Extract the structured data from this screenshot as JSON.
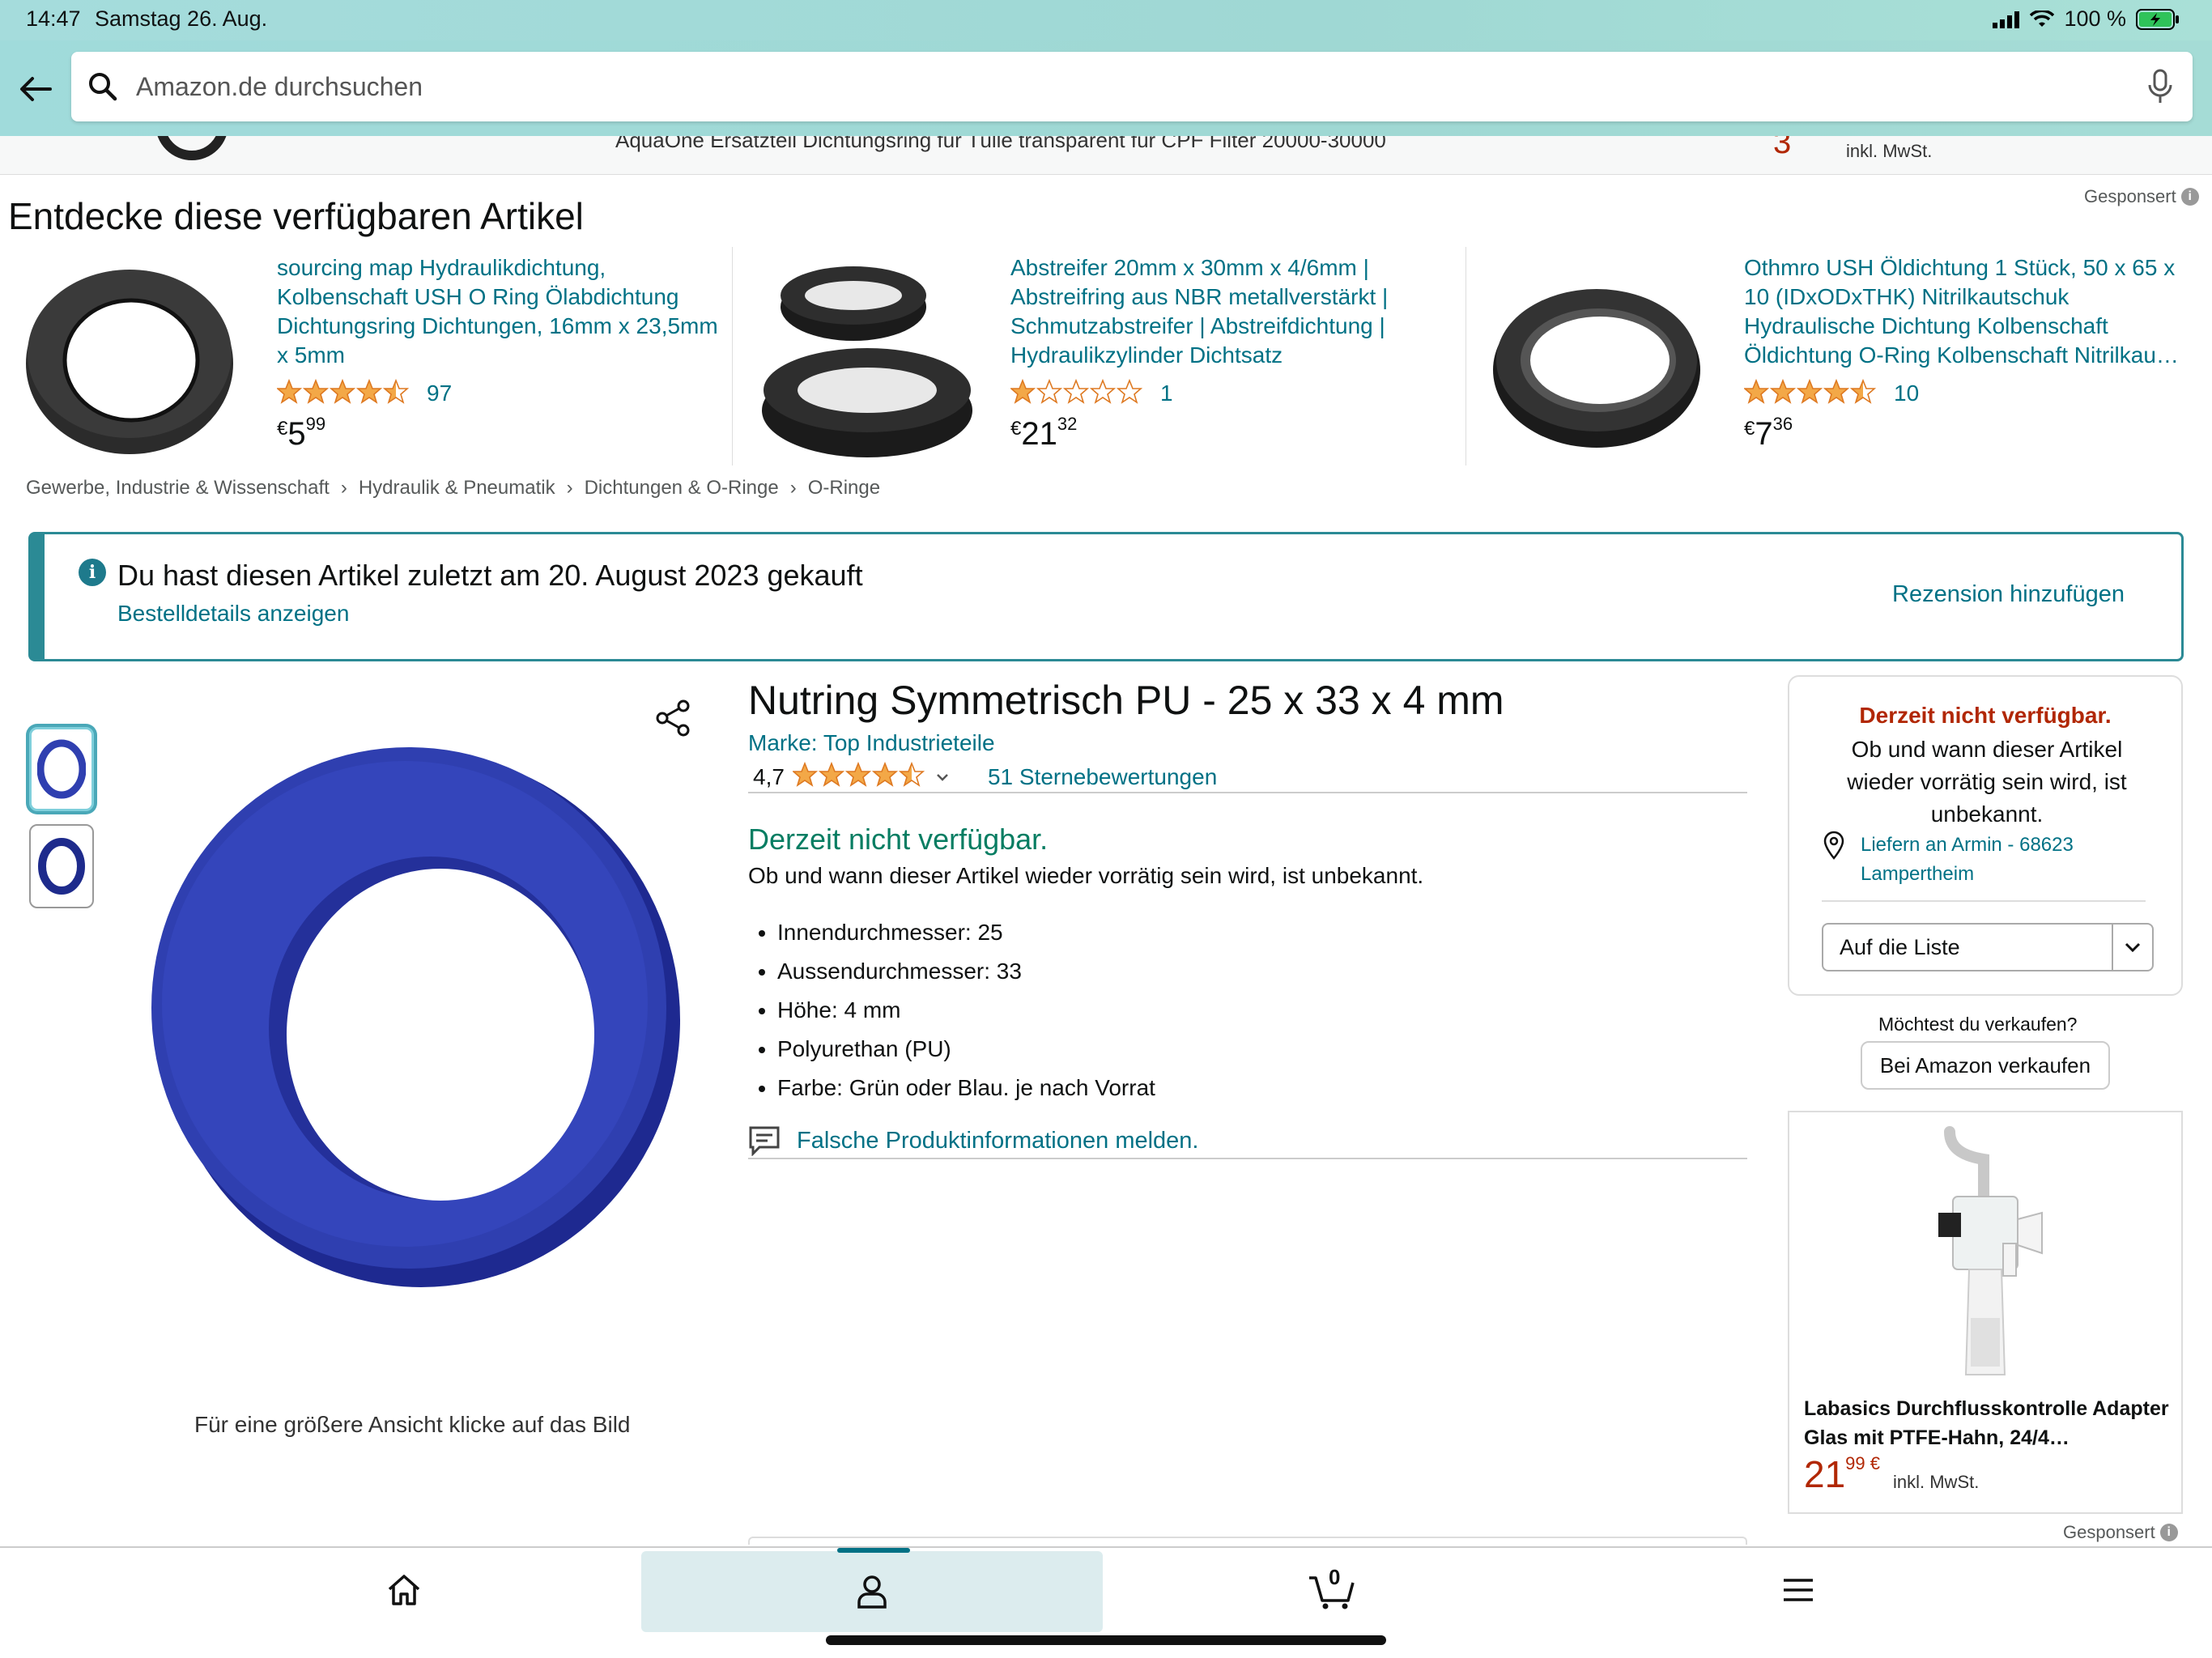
{
  "status_bar": {
    "time": "14:47",
    "date": "Samstag 26. Aug.",
    "battery": "100 %"
  },
  "search": {
    "placeholder": "Amazon.de durchsuchen"
  },
  "sticky": {
    "title": "AquaOne Ersatzteil Dichtungsring für Tülle transparent für CPF Filter 20000-30000",
    "price": "3",
    "tax": "inkl. MwSt."
  },
  "discover": {
    "heading": "Entdecke diese verfügbaren Artikel",
    "sponsored": "Gesponsert",
    "items": [
      {
        "title": "sourcing map Hydraulikdichtung, Kolbenschaft USH O Ring Ölabdichtung Dichtungsring Dichtungen, 16mm x 23,5mm x 5mm",
        "rating": 4.5,
        "reviews": "97",
        "currency": "€",
        "price_whole": "5",
        "price_frac": "99"
      },
      {
        "title": "Abstreifer 20mm x 30mm x 4/6mm | Abstreifring aus NBR metallverstärkt | Schmutzabstreifer | Abstreifdichtung | Hydraulikzylinder Dichtsatz",
        "rating": 1,
        "reviews": "1",
        "currency": "€",
        "price_whole": "21",
        "price_frac": "32"
      },
      {
        "title": "Othmro USH Öldichtung 1 Stück, 50 x 65 x 10 (IDxODxTHK) Nitrilkautschuk Hydraulische Dichtung Kolbenschaft Öldichtung O-Ring Kolbenschaft Nitrilkau…",
        "rating": 4.5,
        "reviews": "10",
        "currency": "€",
        "price_whole": "7",
        "price_frac": "36"
      }
    ]
  },
  "breadcrumb": [
    "Gewerbe, Industrie & Wissenschaft",
    "›",
    "Hydraulik & Pneumatik",
    "›",
    "Dichtungen & O-Ringe",
    "›",
    "O-Ringe"
  ],
  "notice": {
    "text": "Du hast diesen Artikel zuletzt am 20. August 2023 gekauft",
    "link": "Bestelldetails anzeigen",
    "action": "Rezension hinzufügen"
  },
  "product": {
    "title": "Nutring Symmetrisch PU - 25 x 33 x 4 mm",
    "brand": "Marke: Top Industrieteile",
    "rating_value": "4,7",
    "rating": 4.5,
    "rating_count": "51 Sternebewertungen",
    "availability": "Derzeit nicht verfügbar.",
    "availability_sub": "Ob und wann dieser Artikel wieder vorrätig sein wird, ist unbekannt.",
    "bullets": [
      "Innendurchmesser: 25",
      "Aussendurchmesser: 33",
      "Höhe: 4 mm",
      "Polyurethan (PU)",
      "Farbe: Grün oder Blau. je nach Vorrat"
    ],
    "report": "Falsche Produktinformationen melden.",
    "image_caption": "Für eine größere Ansicht klicke auf das Bild",
    "ring_color": "#2f3fb0"
  },
  "buybox": {
    "unavailable": "Derzeit nicht verfügbar.",
    "unavailable_sub": "Ob und wann dieser Artikel wieder vorrätig sein wird, ist unbekannt.",
    "deliver": "Liefern an Armin - 68623 Lampertheim",
    "list_label": "Auf die Liste",
    "sell_question": "Möchtest du verkaufen?",
    "sell_button": "Bei Amazon verkaufen"
  },
  "ad": {
    "title": "Labasics Durchflusskontrolle Adapter Glas mit PTFE-Hahn, 24/4…",
    "price_whole": "21",
    "price_frac": "99 €",
    "tax": "inkl. MwSt.",
    "sponsored": "Gesponsert"
  },
  "nav": {
    "cart_count": "0"
  },
  "colors": {
    "accent": "#007185",
    "price_red": "#b12704",
    "star": "#f3a847",
    "available_green": "#067d62"
  }
}
